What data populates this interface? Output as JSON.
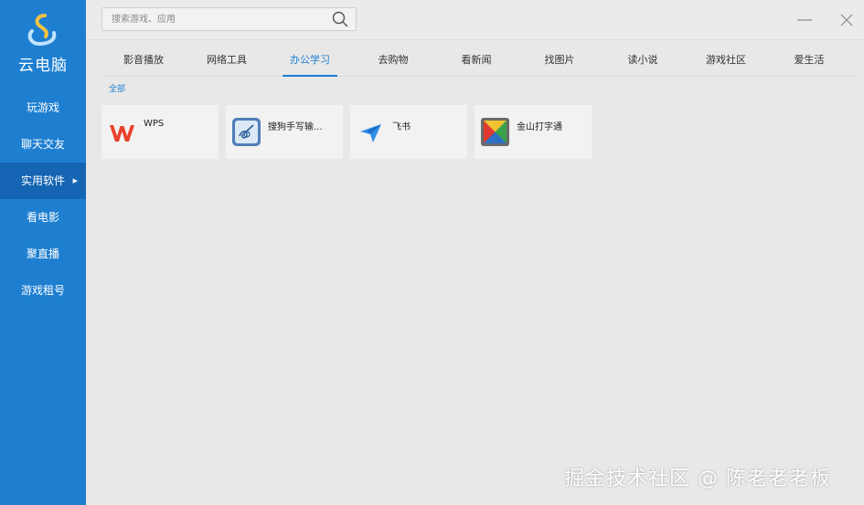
{
  "app": {
    "logo_text": "云电脑"
  },
  "sidebar": {
    "items": [
      {
        "label": "玩游戏",
        "active": false
      },
      {
        "label": "聊天交友",
        "active": false
      },
      {
        "label": "实用软件",
        "active": true
      },
      {
        "label": "看电影",
        "active": false
      },
      {
        "label": "聚直播",
        "active": false
      },
      {
        "label": "游戏租号",
        "active": false
      }
    ]
  },
  "search": {
    "placeholder": "搜索游戏、应用",
    "value": ""
  },
  "tabs": [
    {
      "label": "影音播放"
    },
    {
      "label": "网络工具"
    },
    {
      "label": "办公学习",
      "active": true
    },
    {
      "label": "去购物"
    },
    {
      "label": "看新闻"
    },
    {
      "label": "找图片"
    },
    {
      "label": "读小说"
    },
    {
      "label": "游戏社区"
    },
    {
      "label": "爱生活"
    }
  ],
  "filter": {
    "label": "全部"
  },
  "apps": [
    {
      "name": "WPS",
      "icon": "wps-icon"
    },
    {
      "name": "搜狗手写输...",
      "icon": "sogou-handwriting-icon"
    },
    {
      "name": "飞书",
      "icon": "feishu-icon"
    },
    {
      "name": "金山打字通",
      "icon": "kingsoft-typing-icon"
    }
  ],
  "watermark": "掘金技术社区 @ 陈老老老板",
  "colors": {
    "accent": "#1e7fd1",
    "sidebar_bg": "#1e7fd1",
    "sidebar_active": "#1565b4",
    "content_bg": "#e8e8e8"
  }
}
